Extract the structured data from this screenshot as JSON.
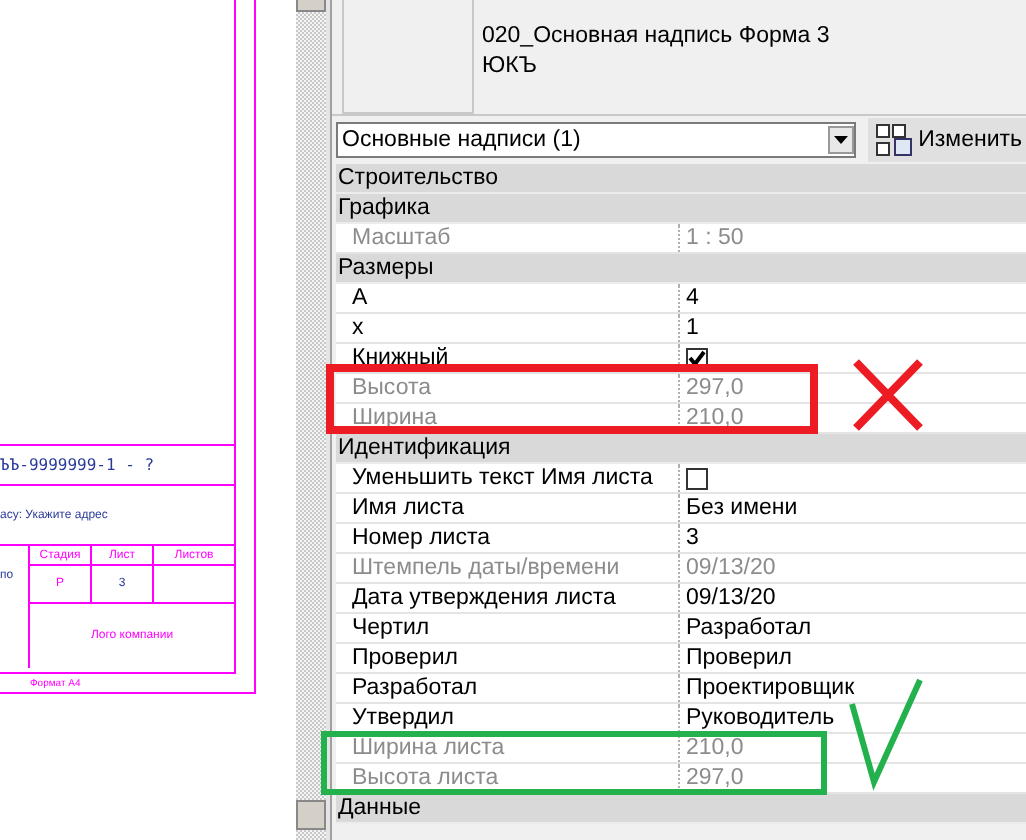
{
  "drawing": {
    "code": "ЪЪ-9999999-1 - ?",
    "address": "асу: Укажите адрес",
    "cut_cell": "по",
    "headers": [
      "Стадия",
      "Лист",
      "Листов"
    ],
    "stage": "Р",
    "sheet": "3",
    "logo": "Лого компании",
    "format": "Формат А4"
  },
  "type_selector": {
    "family": "020_Основная надпись Форма 3",
    "type": "ЮКЪ"
  },
  "instance_dropdown": {
    "value": "Основные надписи (1)"
  },
  "edit_type_button": {
    "label": "Изменить"
  },
  "properties": [
    {
      "kind": "group",
      "label": "Строительство"
    },
    {
      "kind": "group",
      "label": "Графика"
    },
    {
      "kind": "row",
      "label": "Масштаб",
      "value": "1 : 50",
      "disabled": true
    },
    {
      "kind": "group",
      "label": "Размеры"
    },
    {
      "kind": "row",
      "label": "A",
      "value": "4",
      "disabled": false
    },
    {
      "kind": "row",
      "label": "x",
      "value": "1",
      "disabled": false
    },
    {
      "kind": "checkbox",
      "label": "Книжный",
      "checked": true,
      "disabled": false
    },
    {
      "kind": "row",
      "label": "Высота",
      "value": "297,0",
      "disabled": true
    },
    {
      "kind": "row",
      "label": "Ширина",
      "value": "210,0",
      "disabled": true
    },
    {
      "kind": "group",
      "label": "Идентификация"
    },
    {
      "kind": "checkbox",
      "label": "Уменьшить текст Имя листа",
      "checked": false,
      "disabled": false
    },
    {
      "kind": "row",
      "label": "Имя листа",
      "value": "Без имени",
      "disabled": false
    },
    {
      "kind": "row",
      "label": "Номер листа",
      "value": "3",
      "disabled": false
    },
    {
      "kind": "row",
      "label": "Штемпель даты/времени",
      "value": "09/13/20",
      "disabled": true
    },
    {
      "kind": "row",
      "label": "Дата утверждения листа",
      "value": "09/13/20",
      "disabled": false
    },
    {
      "kind": "row",
      "label": "Чертил",
      "value": "Разработал",
      "disabled": false
    },
    {
      "kind": "row",
      "label": "Проверил",
      "value": "Проверил",
      "disabled": false
    },
    {
      "kind": "row",
      "label": "Разработал",
      "value": "Проектировщик",
      "disabled": false
    },
    {
      "kind": "row",
      "label": "Утвердил",
      "value": "Руководитель",
      "disabled": false
    },
    {
      "kind": "row",
      "label": "Ширина листа",
      "value": "210,0",
      "disabled": true
    },
    {
      "kind": "row",
      "label": "Высота листа",
      "value": "297,0",
      "disabled": true
    },
    {
      "kind": "group",
      "label": "Данные"
    }
  ],
  "markup": [
    {
      "kind": "cross",
      "color": "#ed1c24"
    },
    {
      "kind": "check",
      "color": "#22b14c"
    }
  ]
}
